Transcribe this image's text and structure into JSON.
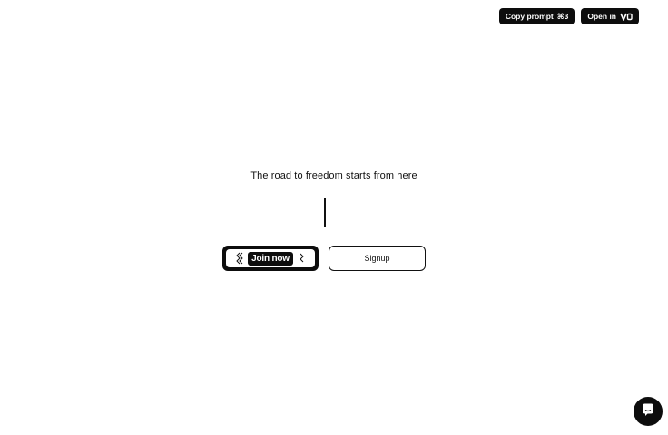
{
  "toolbar": {
    "copy_prompt_label": "Copy prompt",
    "copy_prompt_shortcut": "⌘3",
    "open_in_label": "Open in",
    "open_in_icon": "v0-logo-icon"
  },
  "hero": {
    "title": "The road to freedom starts from here"
  },
  "actions": {
    "join_label": "Join now",
    "signup_label": "Signup"
  },
  "chat": {
    "icon": "chat-bubble-icon"
  },
  "colors": {
    "background": "#ffffff",
    "primary": "#0d0d0d",
    "text": "#111111"
  }
}
